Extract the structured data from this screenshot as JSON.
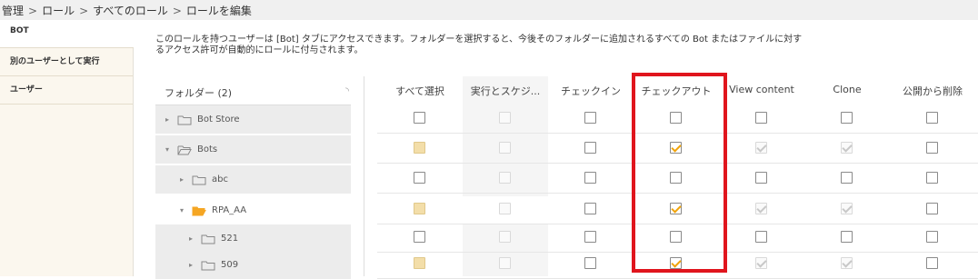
{
  "breadcrumb": [
    "管理",
    "ロール",
    "すべてのロール",
    "ロールを編集"
  ],
  "breadcrumb_sep": ">",
  "sidebar": {
    "items": [
      {
        "label": "BOT",
        "active": true
      },
      {
        "label": "別のユーザーとして実行",
        "active": false
      },
      {
        "label": "ユーザー",
        "active": false
      }
    ]
  },
  "description": "このロールを持つユーザーは [Bot] タブにアクセスできます。フォルダーを選択すると、今後そのフォルダーに追加されるすべての Bot またはファイルに対するアクセス許可が自動的にロールに付与されます。",
  "folders": {
    "header": "フォルダー (2)",
    "rows": [
      {
        "name": "Bot Store",
        "expanded": false,
        "level": 0
      },
      {
        "name": "Bots",
        "expanded": true,
        "level": 0
      },
      {
        "name": "abc",
        "expanded": false,
        "level": 1
      },
      {
        "name": "RPA_AA",
        "expanded": true,
        "level": 1,
        "selected": true
      },
      {
        "name": "521",
        "expanded": false,
        "level": 2
      },
      {
        "name": "509",
        "expanded": false,
        "level": 2
      }
    ]
  },
  "columns": [
    "すべて選択",
    "実行とスケジ...",
    "チェックイン",
    "チェックアウト",
    "View content",
    "Clone",
    "公開から削除"
  ],
  "permissions": [
    [
      "unchecked",
      "disabled",
      "unchecked",
      "unchecked",
      "unchecked",
      "unchecked",
      "unchecked"
    ],
    [
      "partial",
      "disabled",
      "unchecked",
      "checked",
      "checked-disabled",
      "checked-disabled",
      "unchecked"
    ],
    [
      "unchecked",
      "disabled",
      "unchecked",
      "unchecked",
      "unchecked",
      "unchecked",
      "unchecked"
    ],
    [
      "partial",
      "disabled",
      "unchecked",
      "checked",
      "checked-disabled",
      "checked-disabled",
      "unchecked"
    ],
    [
      "unchecked",
      "disabled",
      "unchecked",
      "unchecked",
      "unchecked",
      "unchecked",
      "unchecked"
    ],
    [
      "partial",
      "disabled",
      "unchecked",
      "checked",
      "checked-disabled",
      "checked-disabled",
      "unchecked"
    ]
  ],
  "highlight_column": "チェックアウト",
  "colors": {
    "accent": "#f0a30a",
    "highlight": "#e0151d",
    "folder_open": "#f5a623",
    "nav_bg": "#fbf7ee"
  }
}
